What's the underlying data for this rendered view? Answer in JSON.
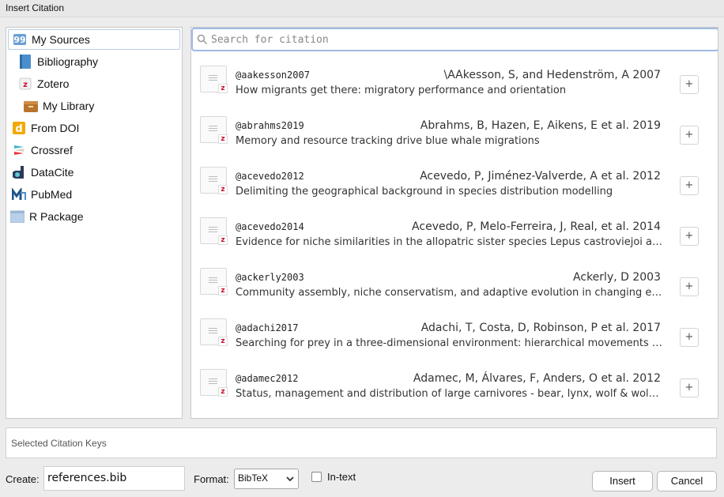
{
  "window": {
    "title": "Insert Citation"
  },
  "sidebar": {
    "items": [
      {
        "label": "My Sources",
        "icon": "quote-icon",
        "selected": true
      },
      {
        "label": "Bibliography",
        "icon": "book-icon"
      },
      {
        "label": "Zotero",
        "icon": "zotero-icon"
      },
      {
        "label": "My Library",
        "icon": "library-icon"
      },
      {
        "label": "From DOI",
        "icon": "doi-icon"
      },
      {
        "label": "Crossref",
        "icon": "crossref-icon"
      },
      {
        "label": "DataCite",
        "icon": "datacite-icon"
      },
      {
        "label": "PubMed",
        "icon": "pubmed-icon"
      },
      {
        "label": "R Package",
        "icon": "r-package-icon"
      }
    ]
  },
  "search": {
    "placeholder": "Search for citation",
    "value": ""
  },
  "citations": [
    {
      "key": "@aakesson2007",
      "authors": "\\AAkesson, S, and Hedenström, A 2007",
      "title": "How migrants get there: migratory performance and orientation",
      "add_label": "+"
    },
    {
      "key": "@abrahms2019",
      "authors": "Abrahms, B, Hazen, E, Aikens, E et al. 2019",
      "title": "Memory and resource tracking drive blue whale migrations",
      "add_label": "+"
    },
    {
      "key": "@acevedo2012",
      "authors": "Acevedo, P, Jiménez-Valverde, A et al. 2012",
      "title": "Delimiting the geographical background in species distribution modelling",
      "add_label": "+"
    },
    {
      "key": "@acevedo2014",
      "authors": "Acevedo, P, Melo-Ferreira, J, Real, et al. 2014",
      "title": "Evidence for niche similarities in the allopatric sister species Lepus castroviejoi a…",
      "add_label": "+"
    },
    {
      "key": "@ackerly2003",
      "authors": "Ackerly, D 2003",
      "title": "Community assembly, niche conservatism, and adaptive evolution in changing e…",
      "add_label": "+"
    },
    {
      "key": "@adachi2017",
      "authors": "Adachi, T, Costa, D, Robinson, P et al. 2017",
      "title": "Searching for prey in a three-dimensional environment: hierarchical movements …",
      "add_label": "+"
    },
    {
      "key": "@adamec2012",
      "authors": "Adamec, M, Álvares, F, Anders, O et al. 2012",
      "title": "Status, management and distribution of large carnivores - bear, lynx, wolf & wol…",
      "add_label": "+"
    }
  ],
  "selected_keys": {
    "placeholder": "Selected Citation Keys"
  },
  "footer": {
    "create_label": "Create:",
    "create_value": "references.bib",
    "format_label": "Format:",
    "format_value": "BibTeX",
    "intext_label": "In-text",
    "insert_label": "Insert",
    "cancel_label": "Cancel"
  }
}
